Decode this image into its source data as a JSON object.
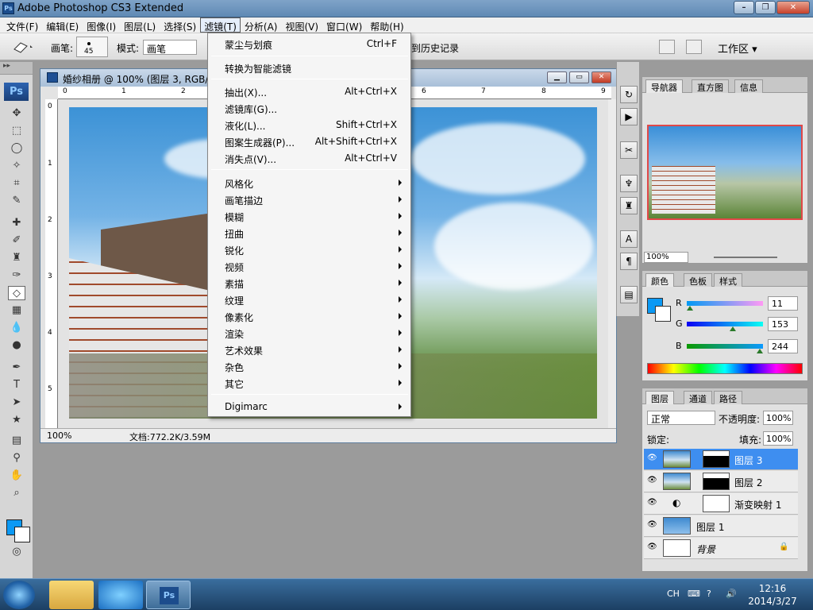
{
  "app": {
    "title": "Adobe Photoshop CS3 Extended",
    "icon": "Ps"
  },
  "menubar": {
    "items": [
      "文件(F)",
      "编辑(E)",
      "图像(I)",
      "图层(L)",
      "选择(S)",
      "滤镜(T)",
      "分析(A)",
      "视图(V)",
      "窗口(W)",
      "帮助(H)"
    ],
    "active": "滤镜(T)"
  },
  "options": {
    "brush_label": "画笔:",
    "brush_size": "45",
    "mode_label": "模式:",
    "mode_value": "画笔",
    "history_text": "到历史记录",
    "workspace": "工作区 ▾"
  },
  "document": {
    "title": "婚纱相册 @ 100% (图层 3, RGB/8",
    "zoom": "100%",
    "doc_info": "文档:772.2K/3.59M",
    "ruler_h": [
      "0",
      "1",
      "2",
      "6",
      "7",
      "8",
      "9"
    ],
    "ruler_v": [
      "0",
      "1",
      "2",
      "3",
      "4",
      "5"
    ]
  },
  "filter_menu": {
    "items": [
      {
        "label": "蒙尘与划痕",
        "shortcut": "Ctrl+F"
      },
      {
        "label": "转换为智能滤镜",
        "shortcut": ""
      },
      {
        "label": "抽出(X)...",
        "shortcut": "Alt+Ctrl+X"
      },
      {
        "label": "滤镜库(G)...",
        "shortcut": ""
      },
      {
        "label": "液化(L)...",
        "shortcut": "Shift+Ctrl+X"
      },
      {
        "label": "图案生成器(P)...",
        "shortcut": "Alt+Shift+Ctrl+X"
      },
      {
        "label": "消失点(V)...",
        "shortcut": "Alt+Ctrl+V"
      },
      {
        "label": "风格化",
        "submenu": true
      },
      {
        "label": "画笔描边",
        "submenu": true
      },
      {
        "label": "模糊",
        "submenu": true
      },
      {
        "label": "扭曲",
        "submenu": true
      },
      {
        "label": "锐化",
        "submenu": true
      },
      {
        "label": "视频",
        "submenu": true
      },
      {
        "label": "素描",
        "submenu": true
      },
      {
        "label": "纹理",
        "submenu": true
      },
      {
        "label": "像素化",
        "submenu": true
      },
      {
        "label": "渲染",
        "submenu": true
      },
      {
        "label": "艺术效果",
        "submenu": true
      },
      {
        "label": "杂色",
        "submenu": true
      },
      {
        "label": "其它",
        "submenu": true
      },
      {
        "label": "Digimarc",
        "submenu": true
      }
    ]
  },
  "navigator": {
    "tabs": [
      "导航器",
      "直方图",
      "信息"
    ],
    "zoom": "100%"
  },
  "color_panel": {
    "tabs": [
      "颜色",
      "色板",
      "样式"
    ],
    "r_label": "R",
    "g_label": "G",
    "b_label": "B",
    "r": "11",
    "g": "153",
    "b": "244",
    "r_fraction": 0.043,
    "g_fraction": 0.6,
    "b_fraction": 0.957,
    "foreground": "#0b99f4"
  },
  "layers_panel": {
    "tabs": [
      "图层",
      "通道",
      "路径"
    ],
    "blend_mode": "正常",
    "opacity_label": "不透明度:",
    "opacity": "100%",
    "lock_label": "锁定:",
    "fill_label": "填充:",
    "fill": "100%",
    "layers": [
      {
        "name": "图层 3",
        "selected": true,
        "mask": true
      },
      {
        "name": "图层 2",
        "selected": false,
        "mask": true
      },
      {
        "name": "渐变映射 1",
        "selected": false,
        "adjust": true
      },
      {
        "name": "图层 1",
        "selected": false
      },
      {
        "name": "背景",
        "selected": false,
        "locked": true
      }
    ]
  },
  "taskbar": {
    "lang": "CH",
    "time": "12:16",
    "date": "2014/3/27",
    "ps_label": "Ps"
  }
}
